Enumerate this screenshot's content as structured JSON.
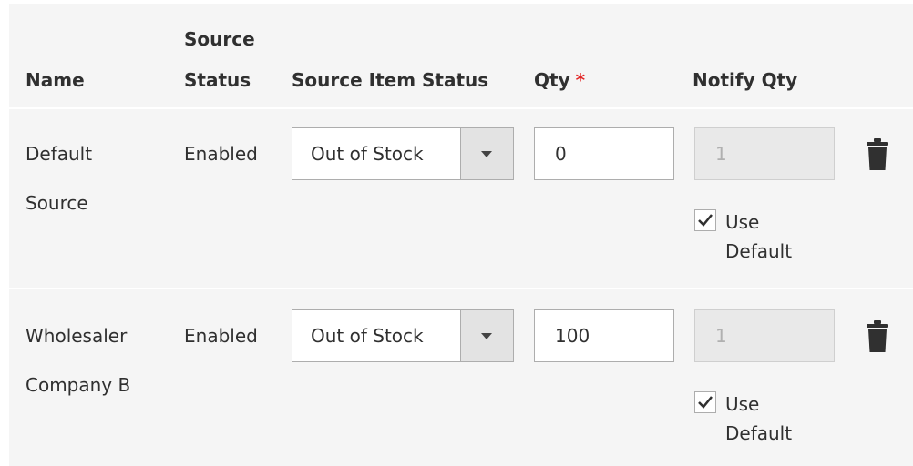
{
  "table": {
    "columns": {
      "name": "Name",
      "source_status_line1": "Source",
      "source_status_line2": "Status",
      "source_item_status": "Source Item Status",
      "qty": "Qty",
      "qty_required_mark": "*",
      "notify_qty": "Notify Qty"
    },
    "rows": [
      {
        "name_line1": "Default",
        "name_line2": "Source",
        "source_status": "Enabled",
        "source_item_status": "Out of Stock",
        "qty": "0",
        "notify_qty": "1",
        "use_default_checked": true,
        "use_default_line1": "Use",
        "use_default_line2": "Default"
      },
      {
        "name_line1": "Wholesaler",
        "name_line2": "Company B",
        "source_status": "Enabled",
        "source_item_status": "Out of Stock",
        "qty": "100",
        "notify_qty": "1",
        "use_default_checked": true,
        "use_default_line1": "Use",
        "use_default_line2": "Default"
      }
    ]
  },
  "icons": {
    "delete": "trash-icon",
    "dropdown": "chevron-down-icon",
    "check": "checkmark-icon"
  },
  "colors": {
    "panel_bg": "#f5f5f5",
    "required": "#e22626",
    "select_arrow_bg": "#e3e3e3",
    "disabled_input_bg": "#e9e9e9"
  }
}
